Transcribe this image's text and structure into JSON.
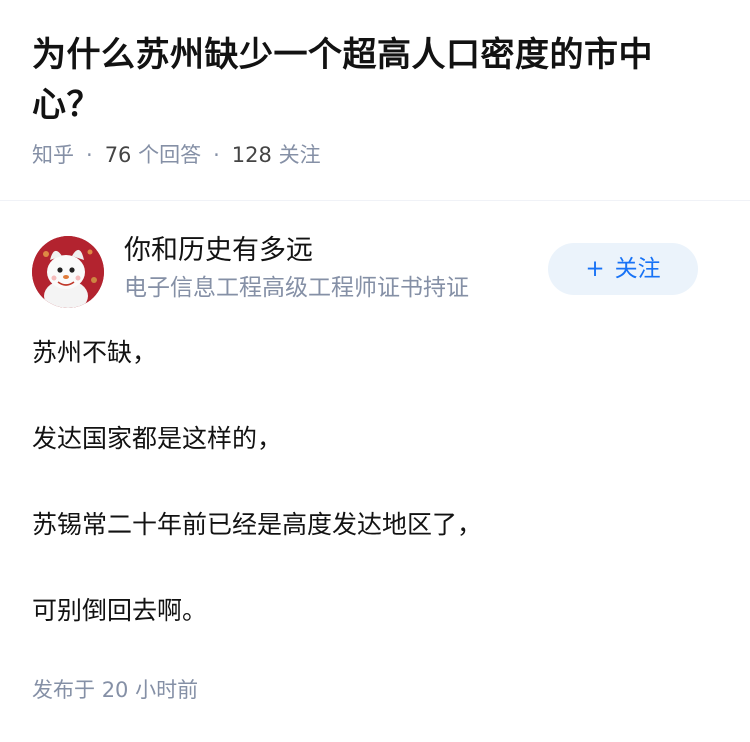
{
  "question": {
    "title": "为什么苏州缺少一个超高人口密度的市中心？",
    "source": "知乎",
    "answers_count": "76",
    "answers_label": "个回答",
    "followers_count": "128",
    "followers_label": "关注"
  },
  "author": {
    "name": "你和历史有多远",
    "headline": "电子信息工程高级工程师证书持证",
    "follow_label": "关注",
    "follow_icon": "plus-icon"
  },
  "answer": {
    "paragraphs": [
      "苏州不缺，",
      "发达国家都是这样的，",
      "苏锡常二十年前已经是高度发达地区了，",
      "可别倒回去啊。"
    ],
    "published_label": "发布于",
    "published_time": "20 小时前"
  },
  "colors": {
    "title": "#121212",
    "meta": "#8590a6",
    "accent": "#1772f6",
    "follow_bg": "#ebf3fb"
  }
}
